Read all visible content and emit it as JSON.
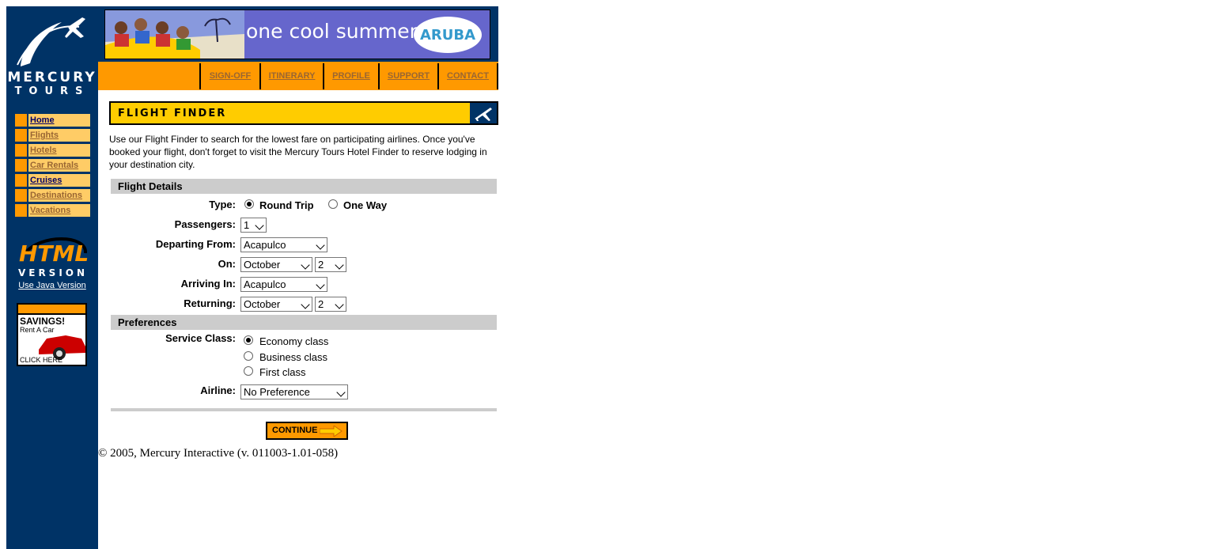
{
  "brand": {
    "name_line1": "MERCURY",
    "name_line2": "TOURS"
  },
  "sidebar": {
    "items": [
      {
        "label": "Home",
        "active": true
      },
      {
        "label": "Flights",
        "active": false
      },
      {
        "label": "Hotels",
        "active": false
      },
      {
        "label": "Car Rentals",
        "active": false
      },
      {
        "label": "Cruises",
        "active": true
      },
      {
        "label": "Destinations",
        "active": false
      },
      {
        "label": "Vacations",
        "active": false
      }
    ],
    "html_version": {
      "line1": "HTML",
      "line2": "VERSION",
      "link": "Use Java Version"
    },
    "ad": {
      "title": "SAVINGS!",
      "subtitle": "Rent A Car",
      "cta": "CLICK HERE"
    }
  },
  "banner": {
    "tagline": "one cool summer",
    "badge": "ARUBA"
  },
  "topnav": [
    "SIGN-OFF",
    "ITINERARY",
    "PROFILE",
    "SUPPORT",
    "CONTACT"
  ],
  "page": {
    "title": "FLIGHT FINDER",
    "intro": "Use our Flight Finder to search for the lowest fare on participating airlines. Once you've booked your flight, don't forget to visit the Mercury Tours Hotel Finder to reserve lodging in your destination city."
  },
  "flight_details": {
    "heading": "Flight Details",
    "type_label": "Type:",
    "type_options": [
      "Round Trip",
      "One Way"
    ],
    "type_selected": "Round Trip",
    "passengers_label": "Passengers:",
    "passengers": "1",
    "departing_label": "Departing From:",
    "departing": "Acapulco",
    "on_label": "On:",
    "on_month": "October",
    "on_day": "2",
    "arriving_label": "Arriving In:",
    "arriving": "Acapulco",
    "returning_label": "Returning:",
    "return_month": "October",
    "return_day": "2"
  },
  "preferences": {
    "heading": "Preferences",
    "service_label": "Service Class:",
    "service_options": [
      "Economy class",
      "Business class",
      "First class"
    ],
    "service_selected": "Economy class",
    "airline_label": "Airline:",
    "airline": "No Preference"
  },
  "continue_label": "CONTINUE",
  "footer": "© 2005, Mercury Interactive (v. 011003-1.01-058)",
  "colors": {
    "navy": "#003366",
    "orange": "#FF9900",
    "yellow": "#FFCC00",
    "gray": "#CCCCCC"
  }
}
